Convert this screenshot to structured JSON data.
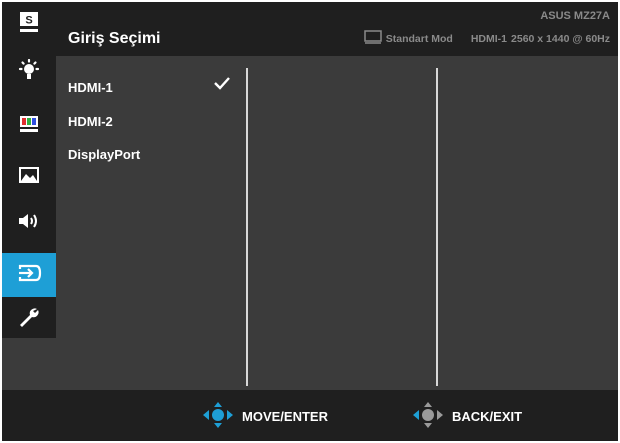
{
  "header": {
    "title": "Giriş Seçimi",
    "model": "ASUS MZ27A",
    "mode": "Standart Mod",
    "input": "HDMI-1",
    "resolution": "2560 x 1440 @ 60Hz"
  },
  "sidebar": {
    "items": [
      {
        "icon": "splendid-s-icon"
      },
      {
        "icon": "brightness-icon"
      },
      {
        "icon": "color-bars-icon"
      },
      {
        "icon": "image-icon"
      },
      {
        "icon": "sound-icon"
      },
      {
        "icon": "input-select-icon",
        "active": true
      },
      {
        "icon": "wrench-icon"
      }
    ],
    "s_letter": "S"
  },
  "options": [
    {
      "label": "HDMI-1",
      "selected": true
    },
    {
      "label": "HDMI-2",
      "selected": false
    },
    {
      "label": "DisplayPort",
      "selected": false
    }
  ],
  "footer": {
    "move_label": "MOVE/ENTER",
    "back_label": "BACK/EXIT"
  },
  "colors": {
    "accent": "#1e9fd6",
    "panel": "#3b3b3b",
    "bar": "#1f1f1f",
    "text": "#ffffff",
    "muted": "#8a8a8a"
  }
}
